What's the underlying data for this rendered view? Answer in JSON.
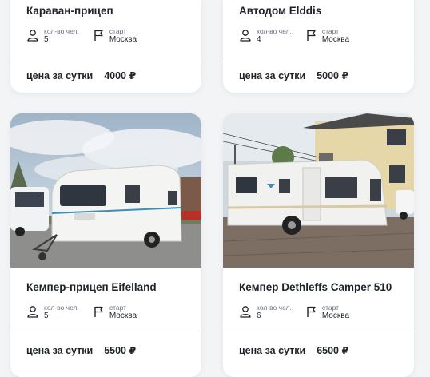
{
  "cards": [
    {
      "title": "Караван-прицеп",
      "capacity_label": "кол-во чел.",
      "capacity": "5",
      "start_label": "старт",
      "start": "Москва",
      "price_label": "цена за сутки",
      "price": "4000 ₽"
    },
    {
      "title": "Автодом Elddis",
      "capacity_label": "кол-во чел.",
      "capacity": "4",
      "start_label": "старт",
      "start": "Москва",
      "price_label": "цена за сутки",
      "price": "5000 ₽"
    },
    {
      "title": "Кемпер-прицеп Eifelland",
      "capacity_label": "кол-во чел.",
      "capacity": "5",
      "start_label": "старт",
      "start": "Москва",
      "price_label": "цена за сутки",
      "price": "5500 ₽"
    },
    {
      "title": "Кемпер Dethleffs Camper 510",
      "capacity_label": "кол-во чел.",
      "capacity": "6",
      "start_label": "старт",
      "start": "Москва",
      "price_label": "цена за сутки",
      "price": "6500 ₽"
    }
  ],
  "icons": {
    "capacity": "person-icon",
    "start": "flag-icon"
  }
}
